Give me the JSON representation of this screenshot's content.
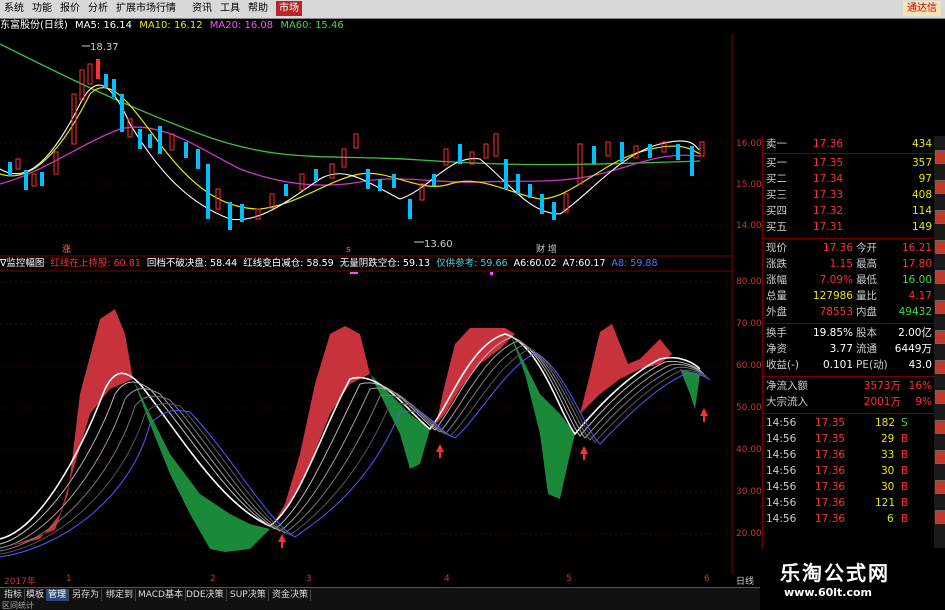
{
  "menu": {
    "items": [
      "系统",
      "功能",
      "报价",
      "分析",
      "扩展市场行情",
      "资讯",
      "工具",
      "帮助"
    ],
    "active": "市场",
    "right_label": "通达信"
  },
  "stock_bar": {
    "name": "东富股份(日线)",
    "ma5": "MA5: 16.14",
    "ma10": "MA10: 16.12",
    "ma20": "MA20: 16.08",
    "ma60": "MA60: 15.46"
  },
  "price_chart": {
    "high_label": "18.37",
    "low_label": "13.60",
    "y_ticks": [
      "16.00",
      "15.00",
      "14.00"
    ],
    "marker_left": "涨",
    "marker_mid": "s",
    "marker_right": "财 增"
  },
  "indicator_bar": {
    "name": "∇监控幅图",
    "s1_label": "红线在上持股:",
    "s1_value": "60.81",
    "s2_label": "回档不破决盘:",
    "s2_value": "58.44",
    "s3_label": "红线变白减仓:",
    "s3_value": "58.59",
    "s4_label": "无量阴跌空仓:",
    "s4_value": "59.13",
    "s5_label": "仅供参考:",
    "s5_value": "59.66",
    "a6": "A6:60.02",
    "a7": "A7:60.17",
    "a8": "A8:",
    "a8_value": "59.88"
  },
  "indicator_axis": [
    "80.00",
    "70.00",
    "60.00",
    "50.00",
    "40.00",
    "30.00",
    "20.00"
  ],
  "time_axis": [
    "2017年",
    "1",
    "2",
    "3",
    "4",
    "5",
    "6"
  ],
  "tabs": [
    "指标",
    "模板",
    "管理",
    "另存为",
    "绑定到",
    "MACD基本",
    "DDE决策",
    "SUP决策",
    "资金决策"
  ],
  "tabs_sub": "区间统计",
  "tab_selected": "管理",
  "axis_right_label": "日线",
  "quote_panel": {
    "sell": [
      {
        "label": "卖一",
        "price": "17.36",
        "vol": "434"
      }
    ],
    "buy": [
      {
        "label": "买一",
        "price": "17.35",
        "vol": "357"
      },
      {
        "label": "买二",
        "price": "17.34",
        "vol": "97"
      },
      {
        "label": "买三",
        "price": "17.33",
        "vol": "408"
      },
      {
        "label": "买四",
        "price": "17.32",
        "vol": "114"
      },
      {
        "label": "买五",
        "price": "17.31",
        "vol": "149"
      }
    ],
    "stats": [
      {
        "a": "现价",
        "b": "17.36",
        "c": "今开",
        "d": "16.21"
      },
      {
        "a": "涨跌",
        "b": "1.15",
        "c": "最高",
        "d": "17.80"
      },
      {
        "a": "涨幅",
        "b": "7.09%",
        "c": "最低",
        "d": "16.00"
      },
      {
        "a": "总量",
        "b": "127986",
        "c": "量比",
        "d": "4.17"
      },
      {
        "a": "外盘",
        "b": "78553",
        "c": "内盘",
        "d": "49432"
      }
    ],
    "stats2": [
      {
        "a": "换手",
        "b": "19.85%",
        "c": "股本",
        "d": "2.00亿"
      },
      {
        "a": "净资",
        "b": "3.77",
        "c": "流通",
        "d": "6449万"
      },
      {
        "a": "收益(-)",
        "b": "0.101",
        "c": "PE(动)",
        "d": "43.0"
      }
    ],
    "flow": [
      {
        "a": "净流入额",
        "b": "3573万",
        "d": "16%"
      },
      {
        "a": "大宗流入",
        "b": "2001万",
        "d": "9%"
      }
    ],
    "ticks": [
      {
        "t": "14:56",
        "p": "17.35",
        "v": "182",
        "s": "S"
      },
      {
        "t": "14:56",
        "p": "17.35",
        "v": "29",
        "s": "B"
      },
      {
        "t": "14:56",
        "p": "17.36",
        "v": "33",
        "s": "B"
      },
      {
        "t": "14:56",
        "p": "17.36",
        "v": "30",
        "s": "B"
      },
      {
        "t": "14:56",
        "p": "17.36",
        "v": "30",
        "s": "B"
      },
      {
        "t": "14:56",
        "p": "17.36",
        "v": "121",
        "s": "B"
      },
      {
        "t": "14:56",
        "p": "17.36",
        "v": "6",
        "s": "B"
      }
    ]
  },
  "brand": {
    "cn": "乐淘公式网",
    "url": "www.60lt.com"
  }
}
